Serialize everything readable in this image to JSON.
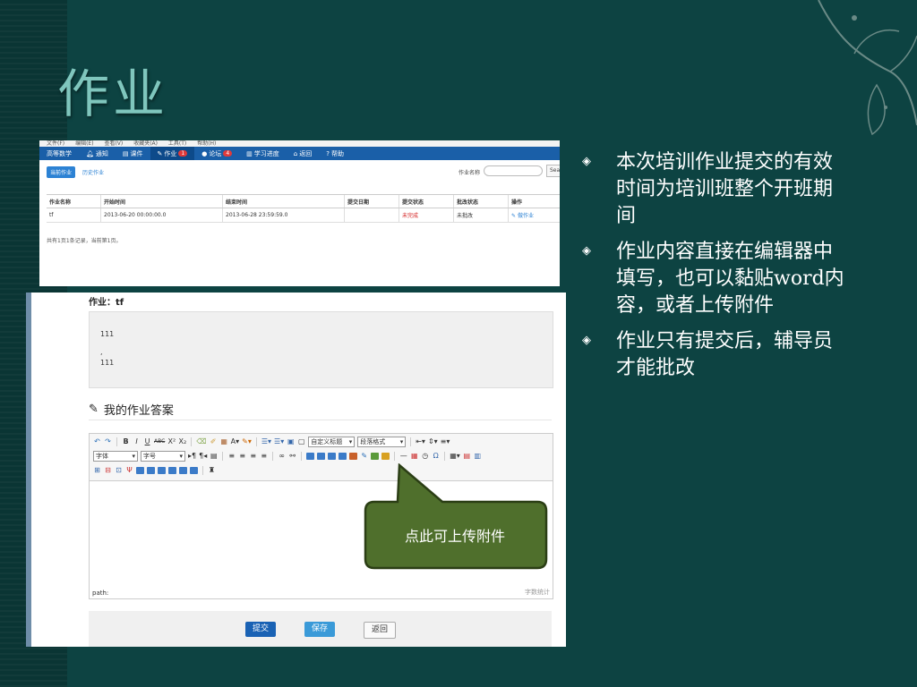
{
  "slide": {
    "title": "作业",
    "bullets": [
      "本次培训作业提交的有效时间为培训班整个开班期间",
      "作业内容直接在编辑器中填写，也可以黏贴word内容，或者上传附件",
      "作业只有提交后，辅导员才能批改"
    ]
  },
  "screenshot1": {
    "menubar": [
      "文件(F)",
      "编辑(E)",
      "查看(V)",
      "收藏夹(A)",
      "工具(T)",
      "帮助(H)"
    ],
    "nav": [
      {
        "label": "高等数学",
        "badge": ""
      },
      {
        "label": "通知",
        "badge": ""
      },
      {
        "label": "课件",
        "badge": ""
      },
      {
        "label": "作业",
        "badge": "1"
      },
      {
        "label": "论坛",
        "badge": "4"
      },
      {
        "label": "学习进度",
        "badge": ""
      },
      {
        "label": "返回",
        "badge": ""
      },
      {
        "label": "帮助",
        "badge": ""
      }
    ],
    "tabs": {
      "current": "当前作业",
      "history": "历史作业"
    },
    "search": {
      "label": "作业名称",
      "button": "Sea"
    },
    "table": {
      "headers": [
        "作业名称",
        "开始时间",
        "结束时间",
        "提交日期",
        "提交状态",
        "批改状态",
        "操作"
      ],
      "row": [
        "tf",
        "2013-06-20 00:00:00.0",
        "2013-06-28 23:59:59.0",
        "",
        "未完成",
        "未批改",
        "做作业"
      ]
    },
    "footer": "共有1页1条记录，当前第1页。"
  },
  "screenshot2": {
    "homework_title": "作业：tf",
    "content_lines": [
      "111",
      ",",
      "111"
    ],
    "answer_heading": "我的作业答案",
    "toolbar": {
      "font_family": "字体",
      "font_size": "字号",
      "custom_heading": "自定义标题",
      "paragraph_format": "段落格式"
    },
    "path_label": "path:",
    "word_count": "字数统计",
    "buttons": {
      "submit": "提交",
      "save": "保存",
      "back": "返回"
    }
  },
  "callout": {
    "text": "点此可上传附件"
  },
  "colors": {
    "background": "#0d4342",
    "title": "#7fc6bd",
    "nav": "#1a5fa8",
    "callout": "#4f6f2c"
  }
}
